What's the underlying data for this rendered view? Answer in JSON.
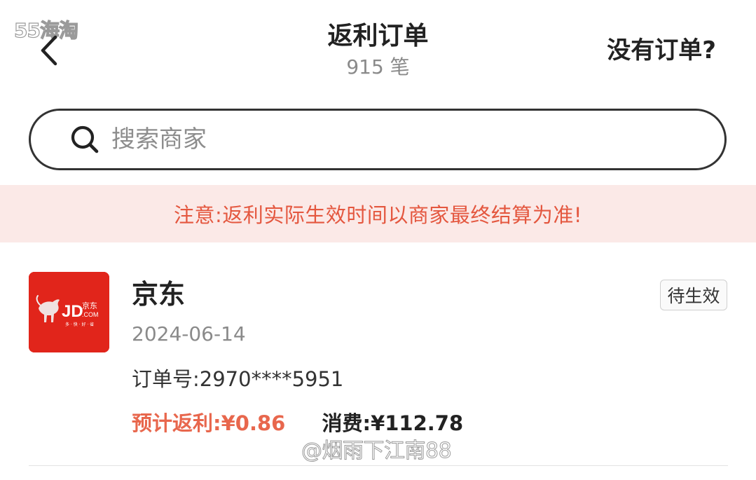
{
  "watermark": {
    "top": "55海淘",
    "bottom": "@烟雨下江南88"
  },
  "header": {
    "back_icon": "chevron-left-icon",
    "title": "返利订单",
    "subtitle": "915 笔",
    "right_link": "没有订单?"
  },
  "search": {
    "icon": "search-icon",
    "placeholder": "搜索商家"
  },
  "notice": {
    "text": "注意:返利实际生效时间以商家最终结算为准!"
  },
  "order": {
    "merchant_logo": {
      "logo_icon": "jd-dog-logo-icon",
      "brand_text": "JD",
      "brand_cn": "京东",
      "brand_dot": ".COM",
      "slogan": "多 · 快 · 好 · 省"
    },
    "merchant_name": "京东",
    "date": "2024-06-14",
    "status": "待生效",
    "order_number_label": "订单号:",
    "order_number": "2970****5951",
    "rebate_label": "预计返利:",
    "rebate_value": "¥0.86",
    "spend_label": "消费:",
    "spend_value": "¥112.78"
  },
  "colors": {
    "accent": "#e4573f",
    "notice_bg": "#fbe9e7",
    "jd_red": "#e1251b"
  }
}
